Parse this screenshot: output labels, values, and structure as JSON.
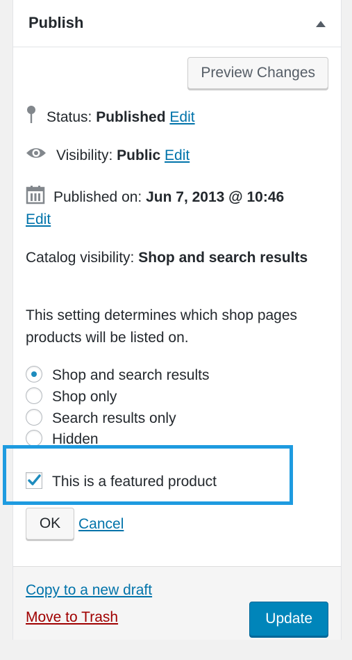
{
  "panel": {
    "title": "Publish",
    "preview_label": "Preview Changes"
  },
  "status": {
    "label": "Status:",
    "value": "Published",
    "edit": "Edit",
    "icon": "pin-icon"
  },
  "visibility": {
    "label": "Visibility:",
    "value": "Public",
    "edit": "Edit",
    "icon": "eye-icon"
  },
  "published_on": {
    "label": "Published on:",
    "value": "Jun 7, 2013 @ 10:46",
    "edit": "Edit",
    "icon": "calendar-icon"
  },
  "catalog": {
    "label": "Catalog visibility:",
    "value": "Shop and search results",
    "description": "This setting determines which shop pages products will be listed on.",
    "options": [
      "Shop and search results",
      "Shop only",
      "Search results only",
      "Hidden"
    ],
    "selected": "Shop and search results",
    "featured_label": "This is a featured product",
    "featured_checked": true,
    "ok": "OK",
    "cancel": "Cancel"
  },
  "footer": {
    "copy_draft": "Copy to a new draft",
    "trash": "Move to Trash",
    "update": "Update"
  },
  "colors": {
    "link": "#0073aa",
    "trash": "#a00000",
    "primary_button": "#0085ba",
    "highlight_border": "#1e9be0",
    "checkmark": "#1e8cbe"
  }
}
